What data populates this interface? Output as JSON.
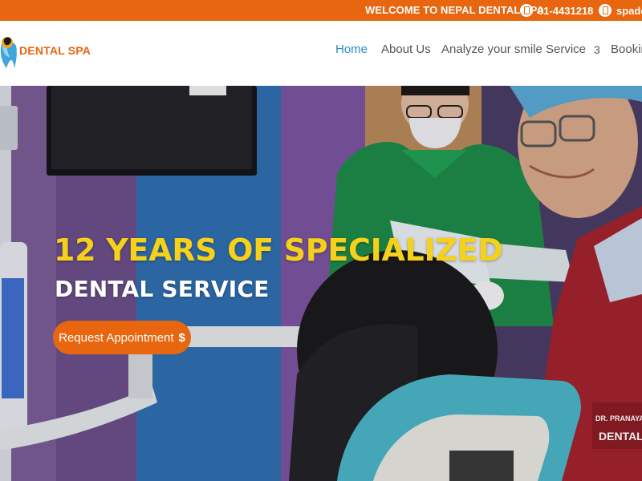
{
  "topbar": {
    "welcome": "WELCOME TO NEPAL DENTAL SPA",
    "phone": "01-4431218",
    "email": "spade",
    "bg_color": "#e8660f"
  },
  "header": {
    "brand": "DENTAL SPA",
    "brand_color": "#e8660f",
    "nav": [
      {
        "label": "Home",
        "active": true
      },
      {
        "label": "About Us"
      },
      {
        "label": "Analyze your smile"
      },
      {
        "label": "Service",
        "icon": "3"
      },
      {
        "label": "Bookin"
      }
    ],
    "active_color": "#2a8bc8"
  },
  "hero": {
    "headline1": "12 YEARS OF SPECIALIZED",
    "headline2": "DENTAL SERVICE",
    "cta_label": "Request Appointment",
    "cta_icon": "$",
    "headline1_color": "#f5d11c",
    "photo_badge_1": "DR. PRANAYA",
    "photo_badge_2": "DENTAL"
  }
}
